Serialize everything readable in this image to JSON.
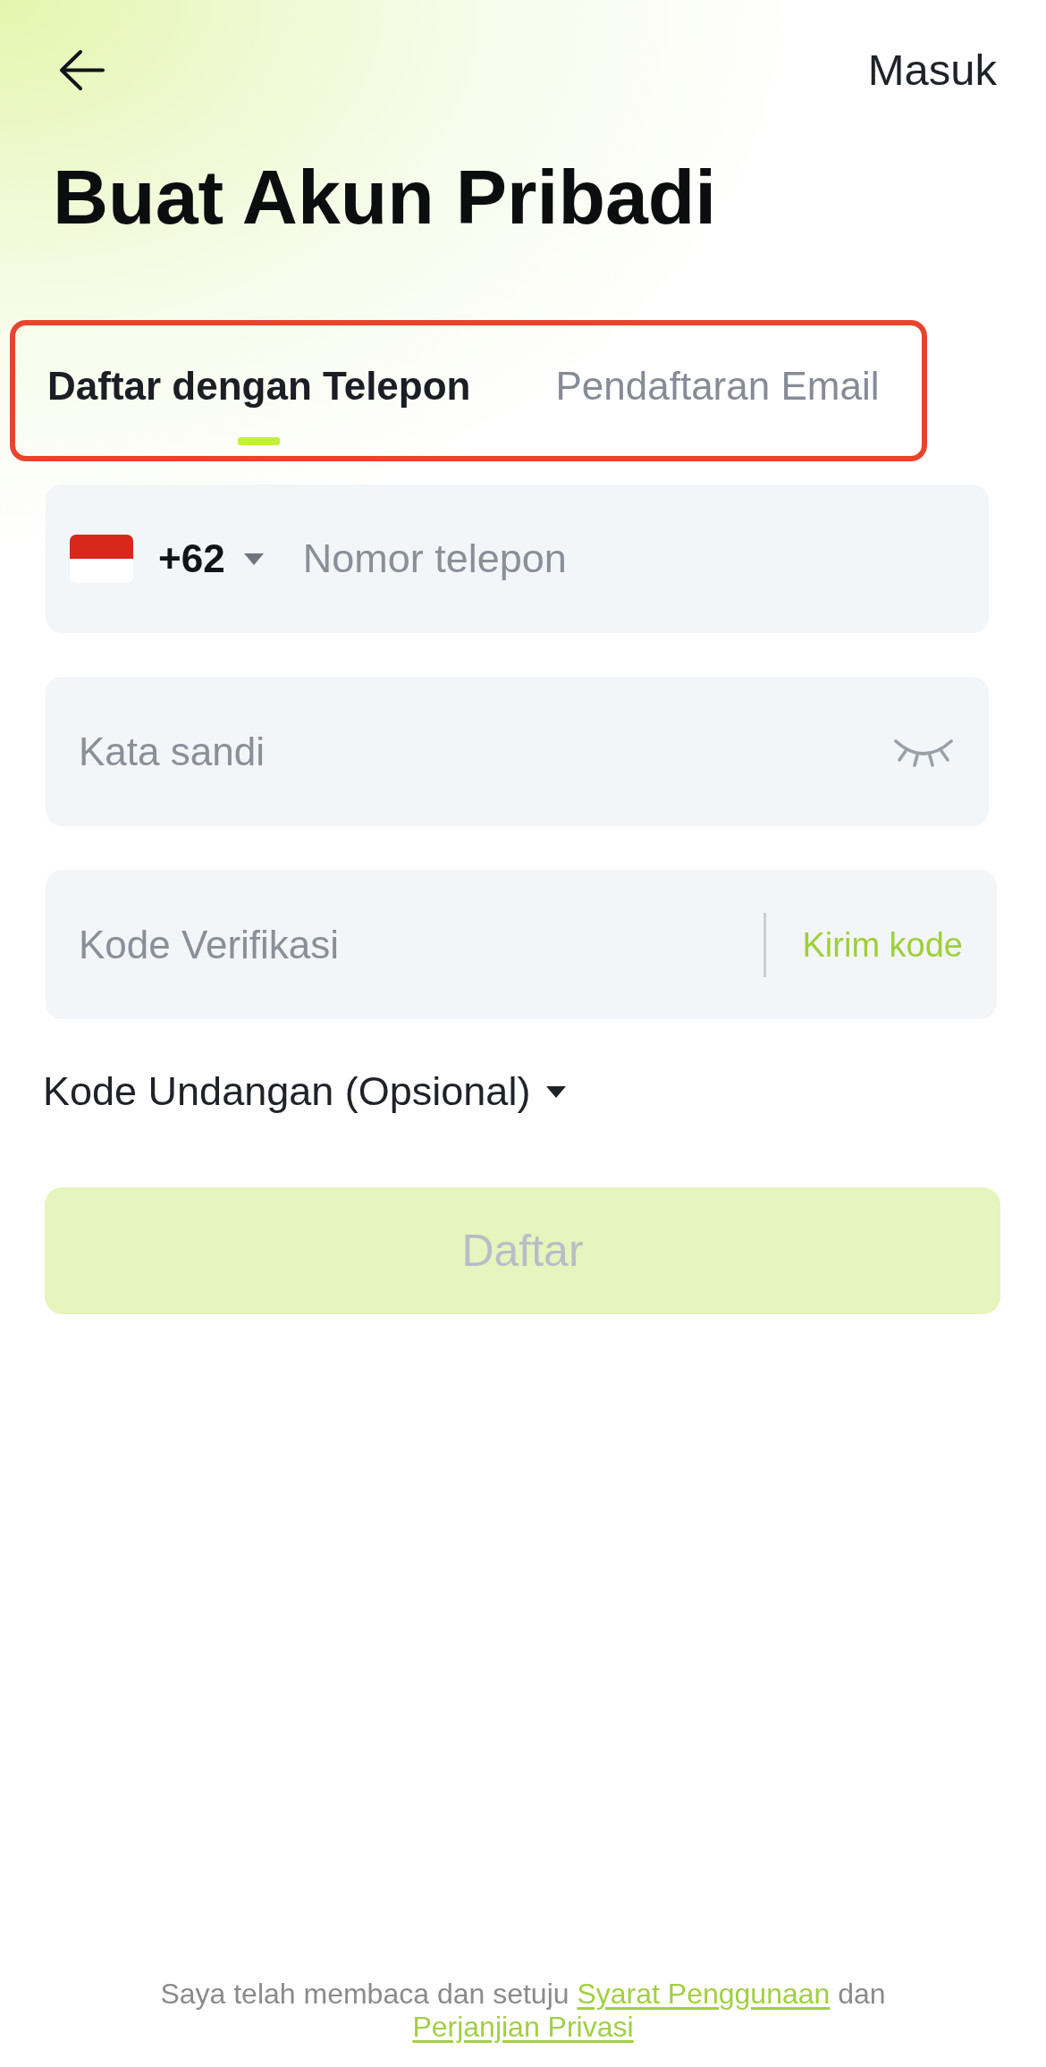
{
  "header": {
    "action_link": "Masuk"
  },
  "title": "Buat Akun Pribadi",
  "tabs": {
    "highlighted": true,
    "items": [
      {
        "label": "Daftar dengan Telepon",
        "selected": true
      },
      {
        "label": "Pendaftaran Email",
        "selected": false
      }
    ]
  },
  "fields": [
    {
      "kind": "phone",
      "country_code": "+62",
      "placeholder": "Nomor telepon"
    },
    {
      "kind": "password",
      "placeholder": "Kata sandi",
      "visible": false
    },
    {
      "kind": "code",
      "placeholder": "Kode Verifikasi",
      "action": "Kirim kode"
    }
  ],
  "invite_toggle": {
    "label": "Kode Undangan (Opsional)",
    "expanded": false
  },
  "submit_button": {
    "label": "Daftar",
    "disabled": true
  },
  "footer": {
    "parts": [
      {
        "kind": "text",
        "text": "Saya telah membaca dan setuju "
      },
      {
        "kind": "link",
        "text": "Syarat Penggunaan"
      },
      {
        "kind": "text",
        "text": " dan "
      },
      {
        "kind": "link",
        "text": "Perjanjian Privasi"
      }
    ]
  }
}
